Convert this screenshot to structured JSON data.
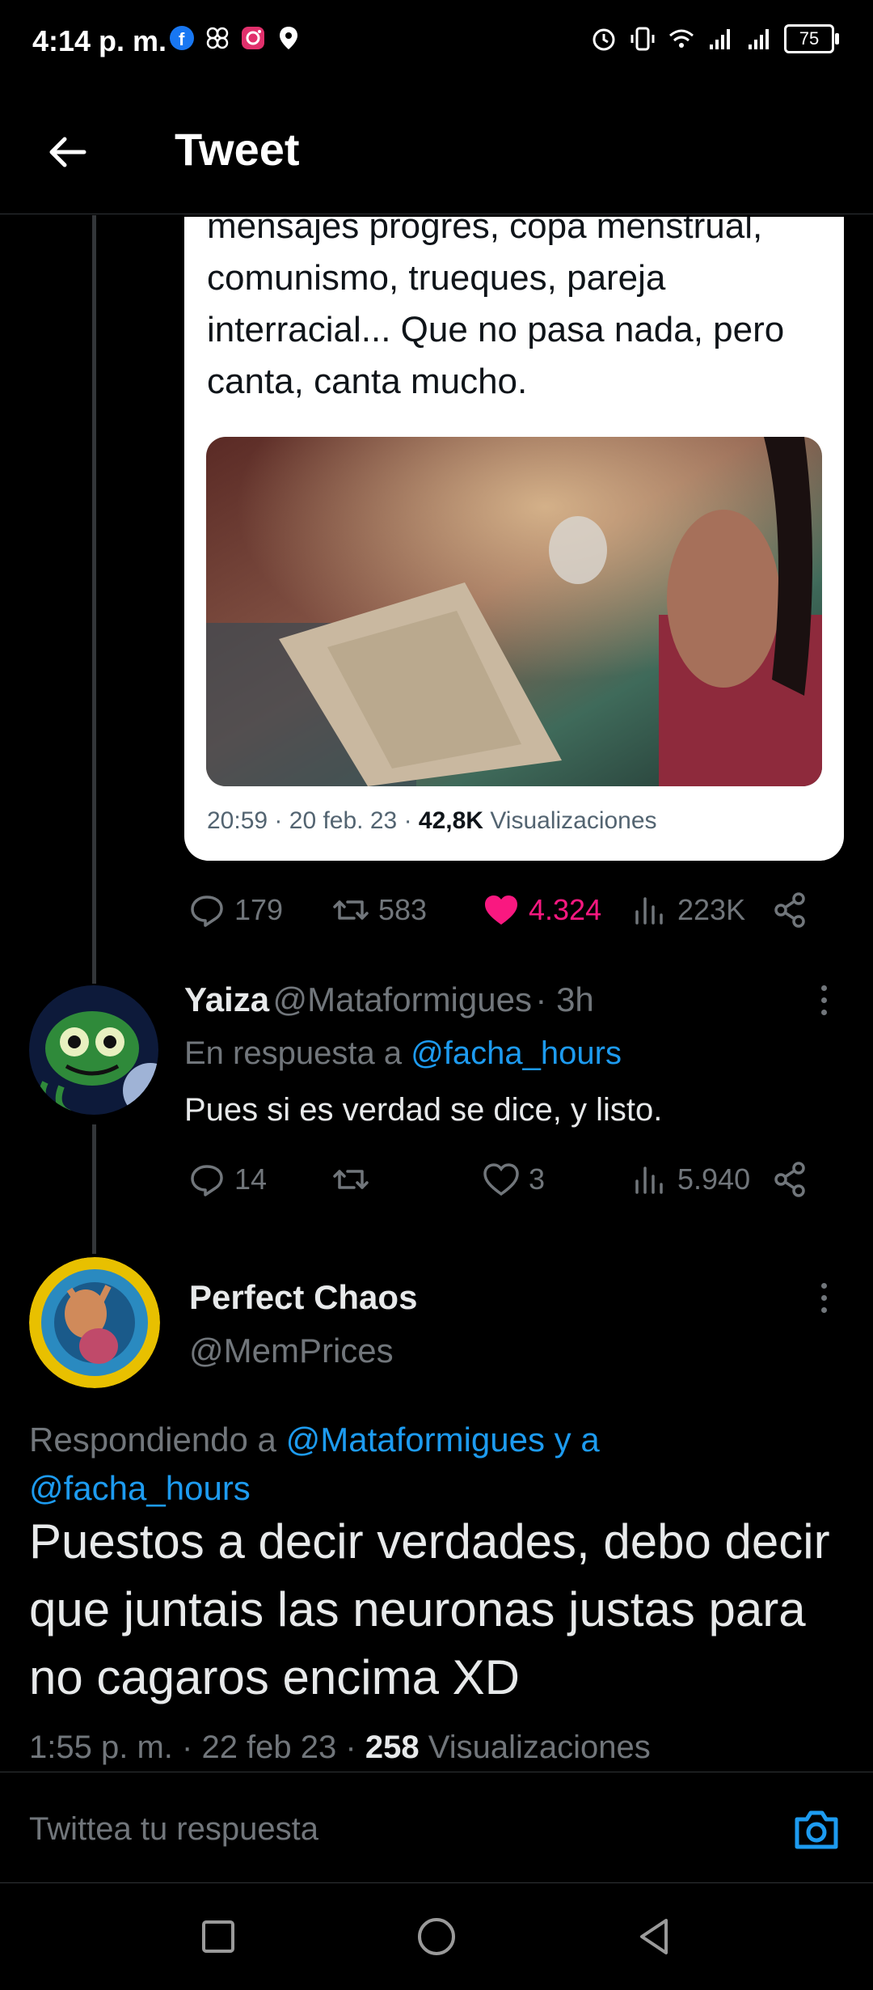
{
  "status_bar": {
    "time": "4:14 p. m.",
    "battery": "75",
    "left_icons": [
      "facebook-icon",
      "pinwheel-icon",
      "instagram-icon",
      "location-icon"
    ],
    "right_icons": [
      "alarm-icon",
      "vibrate-icon",
      "wifi-icon",
      "signal-icon",
      "signal-icon"
    ]
  },
  "header": {
    "title": "Tweet"
  },
  "quoted_tweet": {
    "text": "mensajes progres, copa menstrual, comunismo, trueques, pareja interracial... Que no pasa nada, pero canta, canta mucho.",
    "image_alt": "photo-hand-holding-menstrual-cup",
    "time": "20:59",
    "date": "20 feb. 23",
    "views_count": "42,8K",
    "views_label": "Visualizaciones",
    "sep": "·"
  },
  "original_actions": {
    "replies": "179",
    "retweets": "583",
    "likes": "4.324",
    "views": "223K",
    "like_color": "#f91880"
  },
  "reply_tweet": {
    "name": "Yaiza",
    "handle": "@Mataformigues",
    "time": "· 3h",
    "replying_prefix": "En respuesta a",
    "replying_to": "@facha_hours",
    "text": "Pues si es verdad se dice, y listo.",
    "replies": "14",
    "retweets": "",
    "likes": "3",
    "views": "5.940"
  },
  "main_tweet": {
    "name": "Perfect Chaos",
    "handle": "@MemPrices",
    "replying_prefix": "Respondiendo a",
    "replying_to_1": "@Mataformigues y a",
    "replying_to_2": "@facha_hours",
    "text": "Puestos a decir verdades, debo decir que juntais las neuronas justas para no cagaros encima XD",
    "time": "1:55 p. m.",
    "date": "22 feb 23",
    "views_count": "258",
    "views_label": "Visualizaciones",
    "sep": "·"
  },
  "reply_bar": {
    "placeholder": "Twittea tu respuesta"
  },
  "colors": {
    "accent": "#1d9bf0",
    "muted": "#71767b",
    "background": "#000000"
  }
}
